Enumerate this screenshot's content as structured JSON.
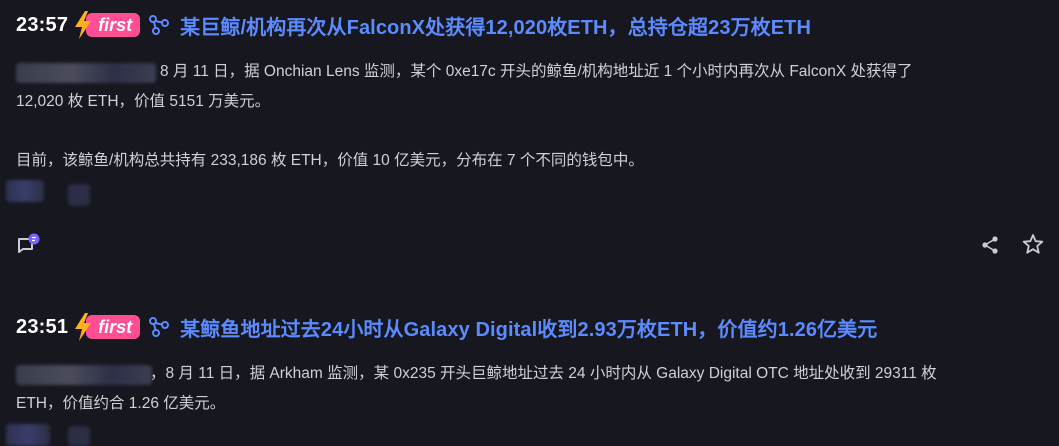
{
  "items": [
    {
      "time": "23:57",
      "badge": "first",
      "title": "某巨鲸/机构再次从FalconX处获得12,020枚ETH，总持仓超23万枚ETH",
      "body": [
        "8 月 11 日，据 Onchian Lens 监测，某个 0xe17c 开头的鲸鱼/机构地址近 1 个小时内再次从 FalconX 处获得了",
        "12,020 枚 ETH，价值 5151 万美元。",
        "目前，该鲸鱼/机构总共持有 233,186 枚 ETH，价值 10 亿美元，分布在 7 个不同的钱包中。"
      ]
    },
    {
      "time": "23:51",
      "badge": "first",
      "title": "某鲸鱼地址过去24小时从Galaxy Digital收到2.93万枚ETH，价值约1.26亿美元",
      "body": [
        "，8 月 11 日，据 Arkham 监测，某 0x235 开头巨鲸地址过去 24 小时内从 Galaxy Digital OTC 地址处收到 29311 枚",
        "ETH，价值约合 1.26 亿美元。"
      ]
    }
  ],
  "icons": {
    "bolt": "lightning-bolt-icon",
    "link": "link-graph-icon",
    "comment": "comment-icon",
    "share": "share-icon",
    "star": "star-icon"
  },
  "colors": {
    "background": "#16171f",
    "title": "#5c8bff",
    "badge": "#ff4e93",
    "bolt": "#ffb11a",
    "text": "#cfd1d9",
    "icon": "#c9ccd6",
    "comment_dot": "#7b61ff"
  }
}
